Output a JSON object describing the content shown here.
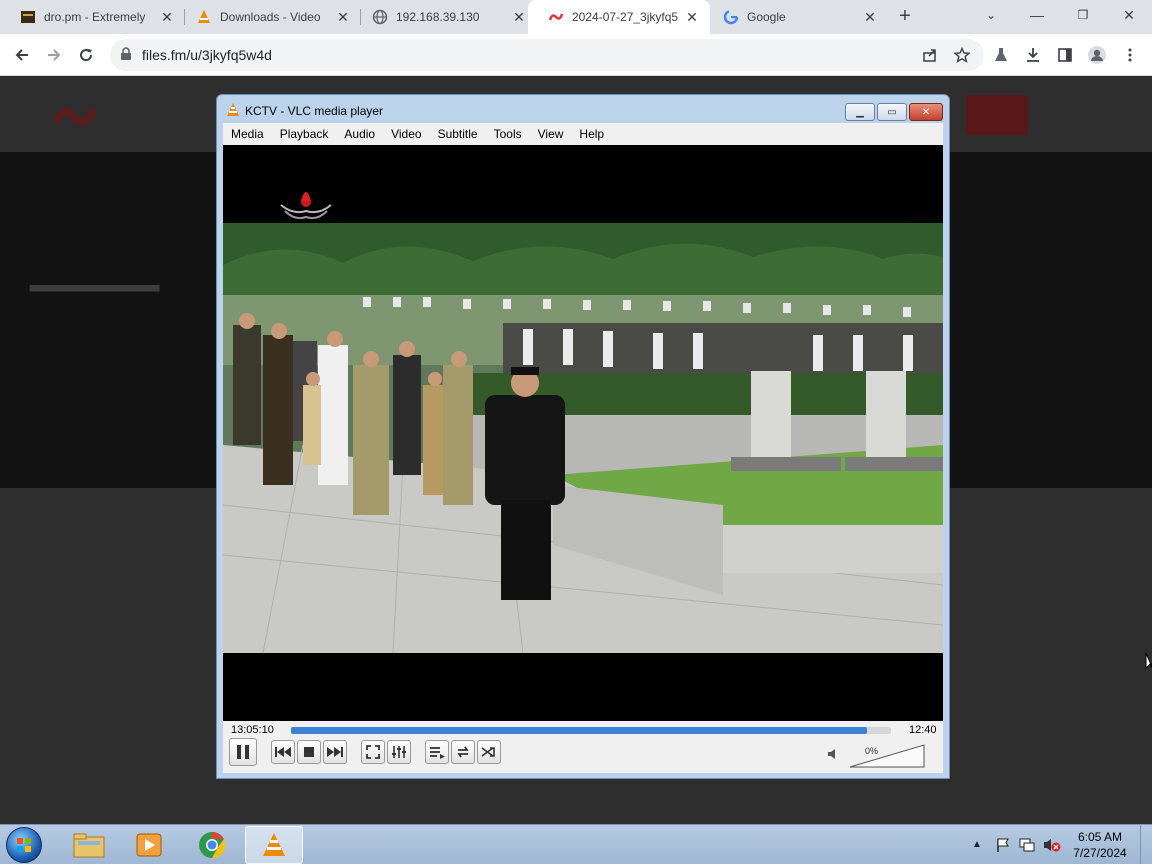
{
  "browser": {
    "tabs": [
      {
        "label": "dro.pm - Extremely",
        "favicon": "dro-favicon"
      },
      {
        "label": "Downloads - Video",
        "favicon": "vlc-cone-icon"
      },
      {
        "label": "192.168.39.130",
        "favicon": "globe-icon"
      },
      {
        "label": "2024-07-27_3jkyfq5",
        "favicon": "filesfm-favicon",
        "active": true
      },
      {
        "label": "Google",
        "favicon": "google-g-icon"
      }
    ],
    "url": "files.fm/u/3jkyfq5w4d"
  },
  "vlc": {
    "title": "KCTV - VLC media player",
    "menu": [
      "Media",
      "Playback",
      "Audio",
      "Video",
      "Subtitle",
      "Tools",
      "View",
      "Help"
    ],
    "elapsed": "13:05:10",
    "remaining": "12:40",
    "progress": 0.96,
    "volume_label": "0%"
  },
  "taskbar": {
    "time": "6:05 AM",
    "date": "7/27/2024"
  },
  "colors": {
    "seek_fill": "#3b82d6",
    "vlc_frame": "#bcd3ec",
    "taskbar": "#b6cbe3"
  }
}
